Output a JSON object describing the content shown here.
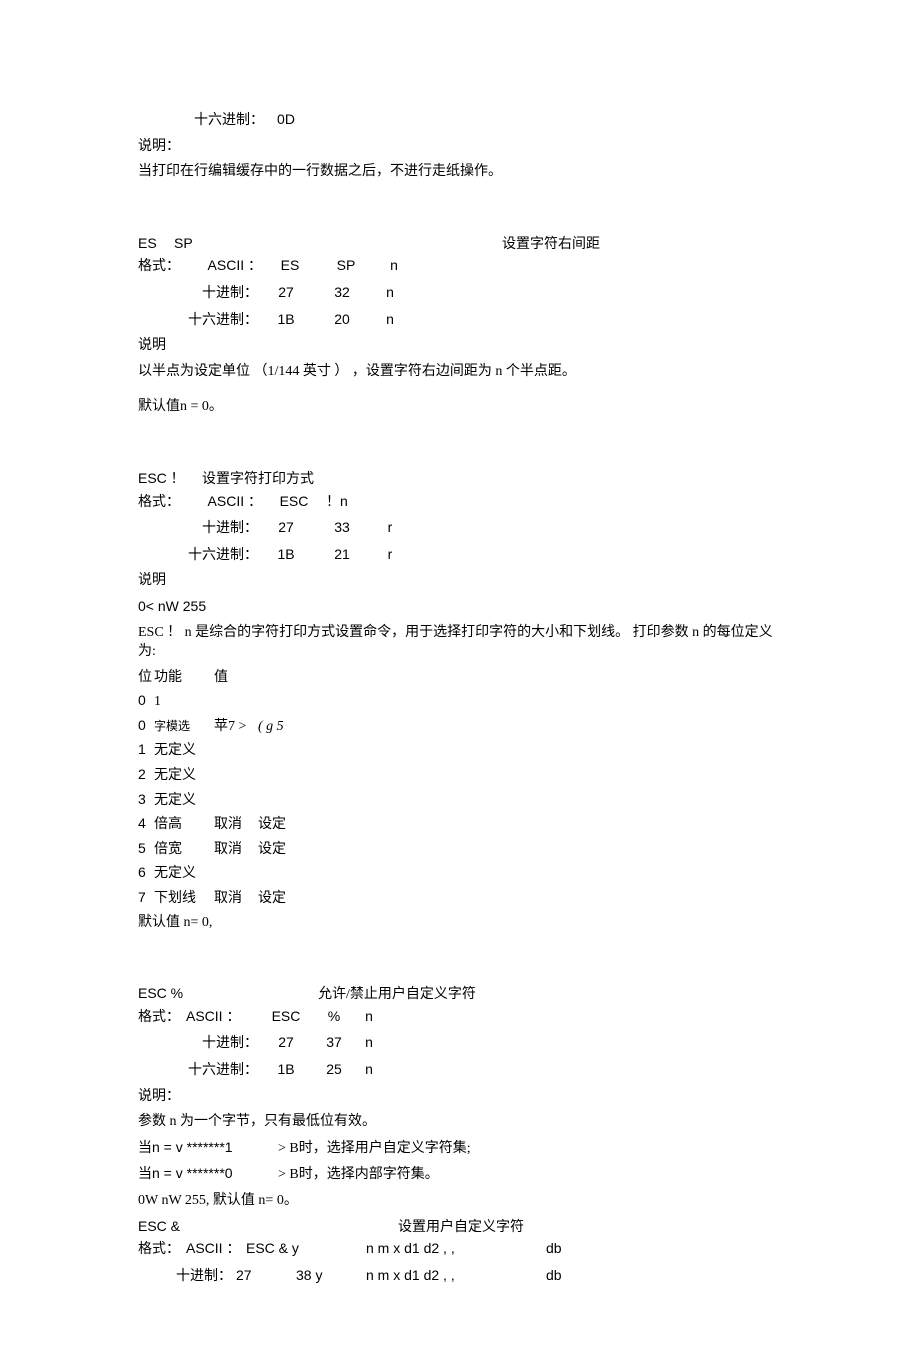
{
  "cr": {
    "hex_label": "十六进制：",
    "hex_val": "0D",
    "desc_header": "说明：",
    "desc_body": "当打印在行编辑缓存中的一行数据之后，不进行走纸操作。"
  },
  "esc_sp": {
    "title_left1": "ES",
    "title_left2": "SP",
    "title_right": "设置字符右间距",
    "format_label": "格式：",
    "ascii_label": "ASCII ：",
    "ascii_c1": "ES",
    "ascii_c2": "SP",
    "ascii_c3": "n",
    "dec_label": "十进制：",
    "dec_c1": "27",
    "dec_c2": "32",
    "dec_c3": "n",
    "hex_label": "十六进制：",
    "hex_c1": "1B",
    "hex_c2": "20",
    "hex_c3": "n",
    "desc_header": "说明",
    "desc_body": "以半点为设定单位 （1/144 英寸 ） ，设置字符右边间距为 n 个半点距。",
    "default": "默认值n = 0。"
  },
  "esc_bang": {
    "title_left": "ESC ！",
    "title_right": "设置字符打印方式",
    "format_label": "格式：",
    "ascii_label": "ASCII ：",
    "ascii_c1": "ESC",
    "ascii_c2": "！n",
    "dec_label": "十进制：",
    "dec_c1": "27",
    "dec_c2": "33",
    "dec_c3": "r",
    "hex_label": "十六进制：",
    "hex_c1": "1B",
    "hex_c2": "21",
    "hex_c3": "r",
    "desc_header": "说明",
    "range": "0< nW 255",
    "desc_body": "ESC ！ n 是综合的字符打印方式设置命令，用于选择打印字符的大小和下划线。 打印参数 n 的每位定义为:",
    "table_header": {
      "c0": "位",
      "c1": "功能",
      "c2": "值"
    },
    "rows": [
      {
        "bit": "0",
        "func": "1",
        "v2": "",
        "v3": ""
      },
      {
        "bit": "0",
        "func": "字模选",
        "v2": "苹7 >",
        "v3": "( g 5"
      },
      {
        "bit": "1",
        "func": "无定义",
        "v2": "",
        "v3": ""
      },
      {
        "bit": "2",
        "func": "无定义",
        "v2": "",
        "v3": ""
      },
      {
        "bit": "3",
        "func": "无定义",
        "v2": "",
        "v3": ""
      },
      {
        "bit": "4",
        "func": "倍高",
        "v2": "取消",
        "v3": "设定"
      },
      {
        "bit": "5",
        "func": "倍宽",
        "v2": "取消",
        "v3": "设定"
      },
      {
        "bit": "6",
        "func": "无定义",
        "v2": "",
        "v3": ""
      },
      {
        "bit": "7",
        "func": "下划线",
        "v2": "取消",
        "v3": "设定"
      }
    ],
    "default": "默认值 n= 0,"
  },
  "esc_pct": {
    "title_left": "ESC %",
    "title_right": "允许/禁止用户自定义字符",
    "format_label": "格式：",
    "ascii_label": "ASCII ：",
    "ascii_c1": "ESC",
    "ascii_c2": "%",
    "ascii_c3": "n",
    "dec_label": "十进制：",
    "dec_c1": "27",
    "dec_c2": "37",
    "dec_c3": "n",
    "hex_label": "十六进制：",
    "hex_c1": "1B",
    "hex_c2": "25",
    "hex_c3": "n",
    "desc_header": "说明：",
    "line1": "参数 n 为一个字节，只有最低位有效。",
    "line2a": "当n = v *******1",
    "line2b": "> B时，选择用户自定义字符集;",
    "line3a": "当n = v *******0",
    "line3b": "> B时，选择内部字符集。",
    "line4": "0W nW 255, 默认值 n= 0。"
  },
  "esc_amp": {
    "title_left": "ESC &",
    "title_right": "设置用户自定义字符",
    "format_label": "格式：",
    "ascii_label": "ASCII ：",
    "ascii_vals": "ESC & y",
    "ascii_mid": "n m x d1 d2 , ,",
    "ascii_end": "db",
    "dec_label": "十进制：",
    "dec_c1": "27",
    "dec_c2": "38 y",
    "dec_mid": "n m x d1 d2 , ,",
    "dec_end": "db"
  }
}
